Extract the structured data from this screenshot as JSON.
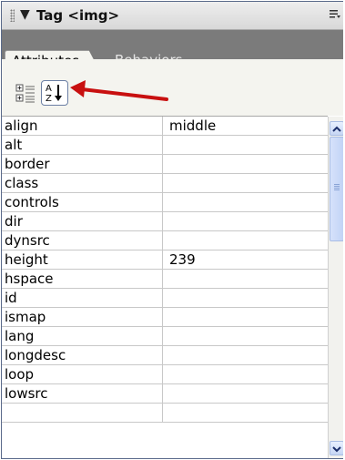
{
  "panel": {
    "title": "Tag <img>",
    "collapse_icon": "triangle-down-icon",
    "options_icon": "panel-options-icon"
  },
  "tabs": [
    {
      "label": "Attributes",
      "active": true
    },
    {
      "label": "Behaviors",
      "active": false
    }
  ],
  "toolbar": {
    "category_view_icon": "category-view-icon",
    "alphabetical_view_icon": "sort-az-icon",
    "annotation_arrow_color": "#cc1111"
  },
  "attributes": [
    {
      "name": "align",
      "value": "middle"
    },
    {
      "name": "alt",
      "value": ""
    },
    {
      "name": "border",
      "value": ""
    },
    {
      "name": "class",
      "value": ""
    },
    {
      "name": "controls",
      "value": ""
    },
    {
      "name": "dir",
      "value": ""
    },
    {
      "name": "dynsrc",
      "value": ""
    },
    {
      "name": "height",
      "value": "239"
    },
    {
      "name": "hspace",
      "value": ""
    },
    {
      "name": "id",
      "value": ""
    },
    {
      "name": "ismap",
      "value": ""
    },
    {
      "name": "lang",
      "value": ""
    },
    {
      "name": "longdesc",
      "value": ""
    },
    {
      "name": "loop",
      "value": ""
    },
    {
      "name": "lowsrc",
      "value": ""
    },
    {
      "name": "",
      "value": ""
    }
  ]
}
